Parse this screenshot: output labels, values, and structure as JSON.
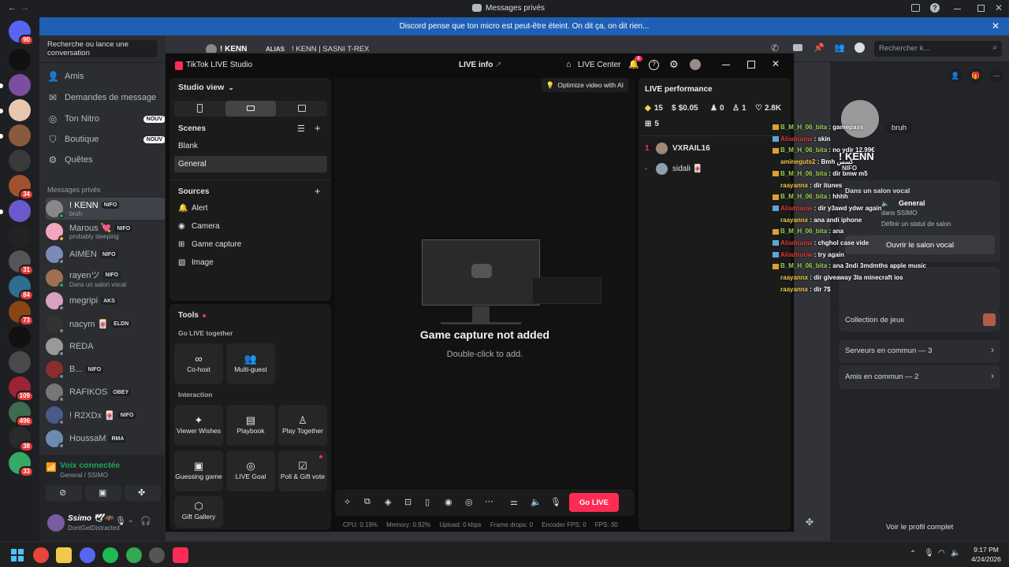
{
  "window": {
    "title": "Messages privés"
  },
  "notice": {
    "text": "Discord pense que ton micro est peut-être éteint. On dit ça, on dit rien..."
  },
  "servers": [
    {
      "badge": "90"
    },
    {
      "badge": ""
    },
    {
      "badge": ""
    },
    {
      "badge": ""
    },
    {
      "badge": ""
    },
    {
      "badge": ""
    },
    {
      "badge": "34"
    },
    {
      "badge": ""
    },
    {
      "badge": ""
    },
    {
      "badge": "31"
    },
    {
      "badge": "84"
    },
    {
      "badge": "73"
    },
    {
      "badge": ""
    },
    {
      "badge": ""
    },
    {
      "badge": "109"
    },
    {
      "badge": "496"
    },
    {
      "badge": "38"
    },
    {
      "badge": "33"
    }
  ],
  "dm_sidebar": {
    "search_placeholder": "Recherche ou lance une conversation",
    "nav": [
      {
        "label": "Amis",
        "badge": ""
      },
      {
        "label": "Demandes de message",
        "badge": ""
      },
      {
        "label": "Ton Nitro",
        "badge": "NOUV"
      },
      {
        "label": "Boutique",
        "badge": "NOUV"
      },
      {
        "label": "Quêtes",
        "badge": ""
      }
    ],
    "section_title": "Messages privés",
    "dms": [
      {
        "name": "! KENN",
        "tag": "NIFO",
        "sub": "bruh"
      },
      {
        "name": "Marous 💘",
        "tag": "NIFO",
        "sub": "probably sleeping"
      },
      {
        "name": "AIMEN",
        "tag": "NIFO",
        "sub": ""
      },
      {
        "name": "rayenツ",
        "tag": "NIFO",
        "sub": "Dans un salon vocal"
      },
      {
        "name": "megripi",
        "tag": "AKS",
        "sub": ""
      },
      {
        "name": "nacym 🀄",
        "tag": "ELDN",
        "sub": ""
      },
      {
        "name": "REDA",
        "tag": "",
        "sub": ""
      },
      {
        "name": "B...",
        "tag": "NIFO",
        "sub": ""
      },
      {
        "name": "RAFIKOS",
        "tag": "OBEY",
        "sub": ""
      },
      {
        "name": "! R2XDx 🀄",
        "tag": "NIFO",
        "sub": ""
      },
      {
        "name": "HoussaM",
        "tag": "RMA",
        "sub": ""
      }
    ],
    "voice": {
      "title": "Voix connectée",
      "sub": "General / SSIMO"
    },
    "user": {
      "name": "Ssimo 🕊🦇",
      "status": "DontGetDistracted"
    }
  },
  "dm_header": {
    "name": "! KENN",
    "alias_label": "ALIAS",
    "alias": "! KENN | SASNI T-REX",
    "search_placeholder": "Rechercher k..."
  },
  "tiktok": {
    "title": "TikTok LIVE Studio",
    "live_info": "LIVE info",
    "live_center": "LIVE Center",
    "notif_count": "4",
    "studio_view": "Studio view",
    "scenes_label": "Scenes",
    "scenes": [
      "Blank",
      "General"
    ],
    "sources_label": "Sources",
    "sources": [
      "Alert",
      "Camera",
      "Game capture",
      "Image"
    ],
    "tools_label": "Tools",
    "go_live_together": "Go LIVE together",
    "together_tools": [
      "Co-host",
      "Multi-guest"
    ],
    "interaction_label": "Interaction",
    "interaction_tools": [
      "Viewer Wishes",
      "Playbook",
      "Play Together",
      "Guessing game",
      "LIVE Goal",
      "Poll & Gift vote",
      "Gift Gallery"
    ],
    "optimize": "Optimize video with AI",
    "canvas_title": "Game capture not added",
    "canvas_sub": "Double-click to add.",
    "go_live": "Go LIVE",
    "performance": {
      "title": "LIVE performance",
      "stats": [
        "15",
        "$0.05",
        "0",
        "1",
        "2.8K",
        "5"
      ]
    },
    "viewers": [
      {
        "rank": "1",
        "name": "VXRAIL16"
      },
      {
        "rank": "-",
        "name": "sidali 🀄"
      }
    ],
    "status": {
      "cpu": "CPU: 0.19%",
      "memory": "Memory: 0.92%",
      "upload": "Upload: 0 kbps",
      "drops": "Frame drops: 0",
      "encoder": "Encoder FPS: 0",
      "fps": "FPS: 30"
    }
  },
  "chat_overlay": [
    {
      "user": "B_M_H_06_bita",
      "color": "u",
      "msg": "gamepass"
    },
    {
      "user": "Aliadnuow",
      "color": "r",
      "msg": "skin"
    },
    {
      "user": "B_M_H_06_bita",
      "color": "u",
      "msg": "no ydir 12.99€"
    },
    {
      "user": "amineguts2",
      "color": "y",
      "msg": "Bmh كسس"
    },
    {
      "user": "B_M_H_06_bita",
      "color": "u",
      "msg": "dir bmw m5"
    },
    {
      "user": "raayannx",
      "color": "y",
      "msg": "dir itunes"
    },
    {
      "user": "B_M_H_06_bita",
      "color": "u",
      "msg": "hhhh"
    },
    {
      "user": "Aliadnuow",
      "color": "r",
      "msg": "dir y3awd ydwr again"
    },
    {
      "user": "raayannx",
      "color": "y",
      "msg": "ana andi iphone"
    },
    {
      "user": "B_M_H_06_bita",
      "color": "u",
      "msg": "ana"
    },
    {
      "user": "Aliadnuow",
      "color": "r",
      "msg": "chghol case vide"
    },
    {
      "user": "Aliadnuow",
      "color": "r",
      "msg": "try again"
    },
    {
      "user": "B_M_H_06_bita",
      "color": "u",
      "msg": "ana 3ndi 3mdmths apple music"
    },
    {
      "user": "raayannx",
      "color": "y",
      "msg": "dir giveaway 3la minecraft ios"
    },
    {
      "user": "raayannx",
      "color": "y",
      "msg": "dir 7$"
    }
  ],
  "profile": {
    "status_bubble": "bruh",
    "name": "! KENN",
    "tag": "NIFO",
    "vocal_title": "Dans un salon vocal",
    "vocal_channel": "General",
    "vocal_server": "dans SSIMO",
    "vocal_status": "Définir un statut de salon",
    "open_vocal": "Ouvrir le salon vocal",
    "games": "Collection de jeux",
    "common_servers": "Serveurs en commun — 3",
    "common_friends": "Amis en commun — 2",
    "full_profile": "Voir le profil complet"
  },
  "taskbar": {
    "time": "9:17 PM",
    "date": "4/24/2026"
  }
}
